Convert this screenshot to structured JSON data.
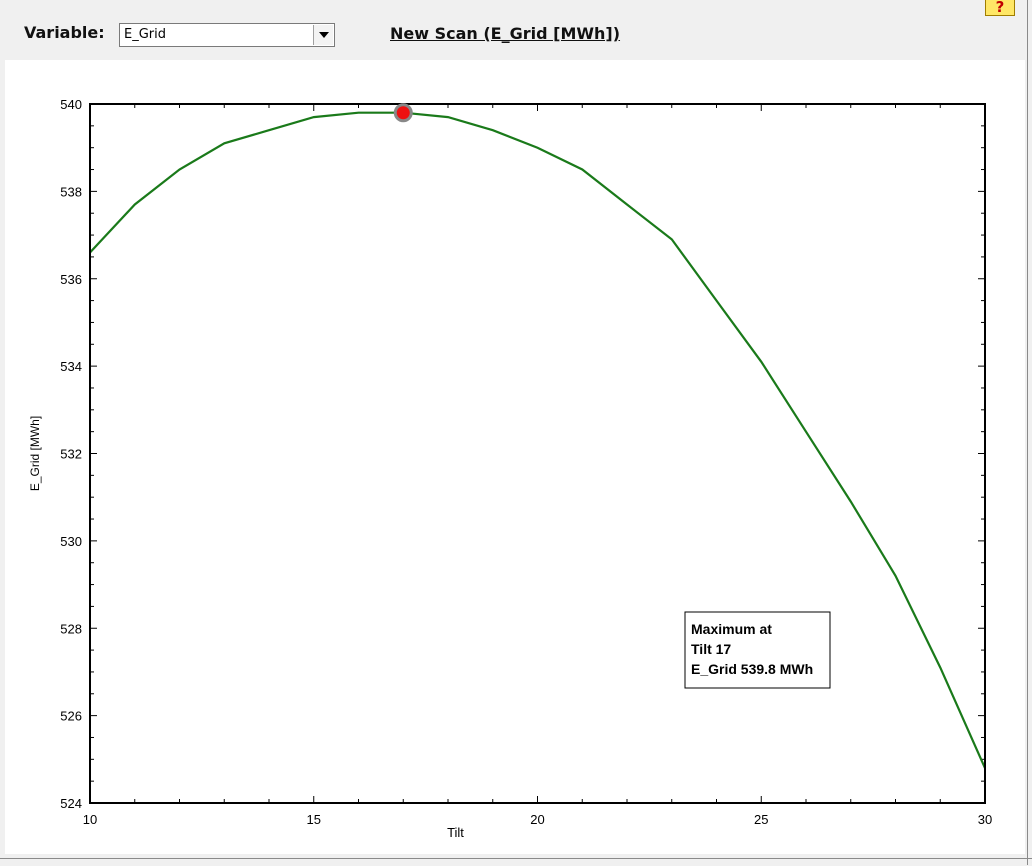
{
  "toolbar": {
    "variable_label": "Variable:",
    "variable_value": "E_Grid",
    "new_scan_label": "New Scan (E_Grid [MWh])",
    "help_label": "?"
  },
  "chart_data": {
    "type": "line",
    "xlabel": "Tilt",
    "ylabel": "E_Grid [MWh]",
    "xlim": [
      10,
      30
    ],
    "ylim": [
      524,
      540
    ],
    "x_ticks": [
      10,
      15,
      20,
      25,
      30
    ],
    "y_ticks": [
      524,
      526,
      528,
      530,
      532,
      534,
      536,
      538,
      540
    ],
    "grid": false,
    "series": [
      {
        "color": "#1a7a1a",
        "x": [
          10,
          11,
          12,
          13,
          14,
          15,
          16,
          17,
          18,
          19,
          20,
          21,
          22,
          23,
          24,
          25,
          26,
          27,
          28,
          29,
          30
        ],
        "y": [
          536.6,
          537.7,
          538.5,
          539.1,
          539.4,
          539.7,
          539.8,
          539.8,
          539.7,
          539.4,
          539.0,
          538.5,
          537.7,
          536.9,
          535.5,
          534.1,
          532.5,
          530.9,
          529.2,
          527.1,
          524.8
        ]
      }
    ],
    "maximum_point": {
      "x": 17,
      "y": 539.8,
      "color": "#ee1111"
    },
    "annotation": {
      "line1": "Maximum at",
      "line2": "Tilt 17",
      "line3": "E_Grid 539.8 MWh"
    }
  }
}
